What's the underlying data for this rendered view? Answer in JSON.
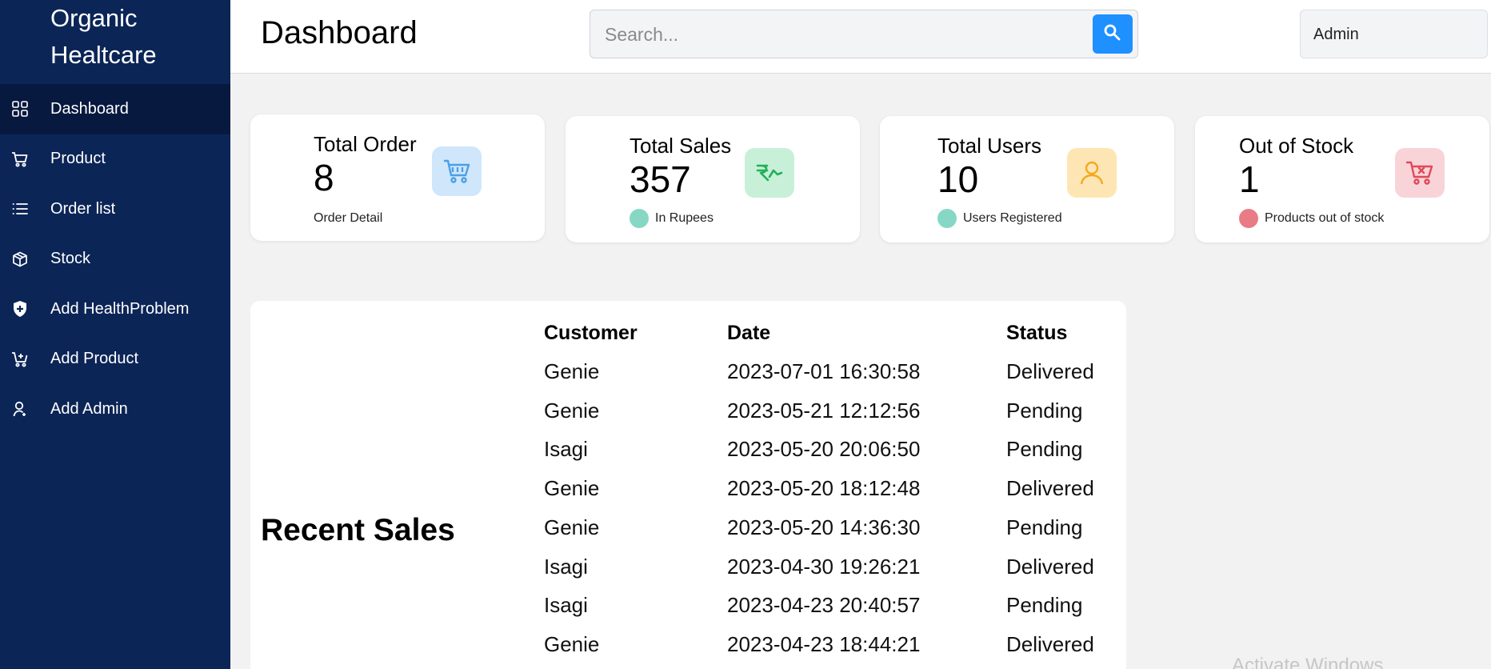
{
  "sidebar": {
    "brand_line1": "Organic",
    "brand_line2": "Healtcare",
    "items": [
      {
        "label": "Dashboard",
        "icon": "grid-icon",
        "active": true
      },
      {
        "label": "Product",
        "icon": "cart-icon"
      },
      {
        "label": "Order list",
        "icon": "list-icon"
      },
      {
        "label": "Stock",
        "icon": "box-icon"
      },
      {
        "label": "Add HealthProblem",
        "icon": "shield-plus-icon"
      },
      {
        "label": "Add Product",
        "icon": "cart-plus-icon"
      },
      {
        "label": "Add Admin",
        "icon": "user-icon"
      }
    ]
  },
  "header": {
    "title": "Dashboard",
    "search_placeholder": "Search...",
    "admin_label": "Admin"
  },
  "cards": [
    {
      "title": "Total Order",
      "value": "8",
      "sub": "Order Detail",
      "icon": "cart-icon",
      "icon_bg": "#cfe6fb",
      "icon_color": "#4a9fe8",
      "dot_color": null
    },
    {
      "title": "Total Sales",
      "value": "357",
      "sub": "In Rupees",
      "icon": "rupee-icon",
      "icon_bg": "#c8f0d8",
      "icon_color": "#21b05a",
      "dot_color": "#86d8c4"
    },
    {
      "title": "Total Users",
      "value": "10",
      "sub": "Users Registered",
      "icon": "user-icon",
      "icon_bg": "#fde6b3",
      "icon_color": "#f4a81d",
      "dot_color": "#86d8c4"
    },
    {
      "title": "Out of Stock",
      "value": "1",
      "sub": "Products out of stock",
      "icon": "cart-x-icon",
      "icon_bg": "#f8d4d8",
      "icon_color": "#e0485a",
      "dot_color": "#e87b86"
    }
  ],
  "recent_sales": {
    "title": "Recent Sales",
    "columns": [
      "Customer",
      "Date",
      "Status"
    ],
    "rows": [
      [
        "Genie",
        "2023-07-01 16:30:58",
        "Delivered"
      ],
      [
        "Genie",
        "2023-05-21 12:12:56",
        "Pending"
      ],
      [
        "Isagi",
        "2023-05-20 20:06:50",
        "Pending"
      ],
      [
        "Genie",
        "2023-05-20 18:12:48",
        "Delivered"
      ],
      [
        "Genie",
        "2023-05-20 14:36:30",
        "Pending"
      ],
      [
        "Isagi",
        "2023-04-30 19:26:21",
        "Delivered"
      ],
      [
        "Isagi",
        "2023-04-23 20:40:57",
        "Pending"
      ],
      [
        "Genie",
        "2023-04-23 18:44:21",
        "Delivered"
      ]
    ]
  },
  "watermark": "Activate Windows",
  "colors": {
    "sidebar": "#0c2557",
    "sidebar_active": "#08193f",
    "accent": "#1e90ff"
  }
}
